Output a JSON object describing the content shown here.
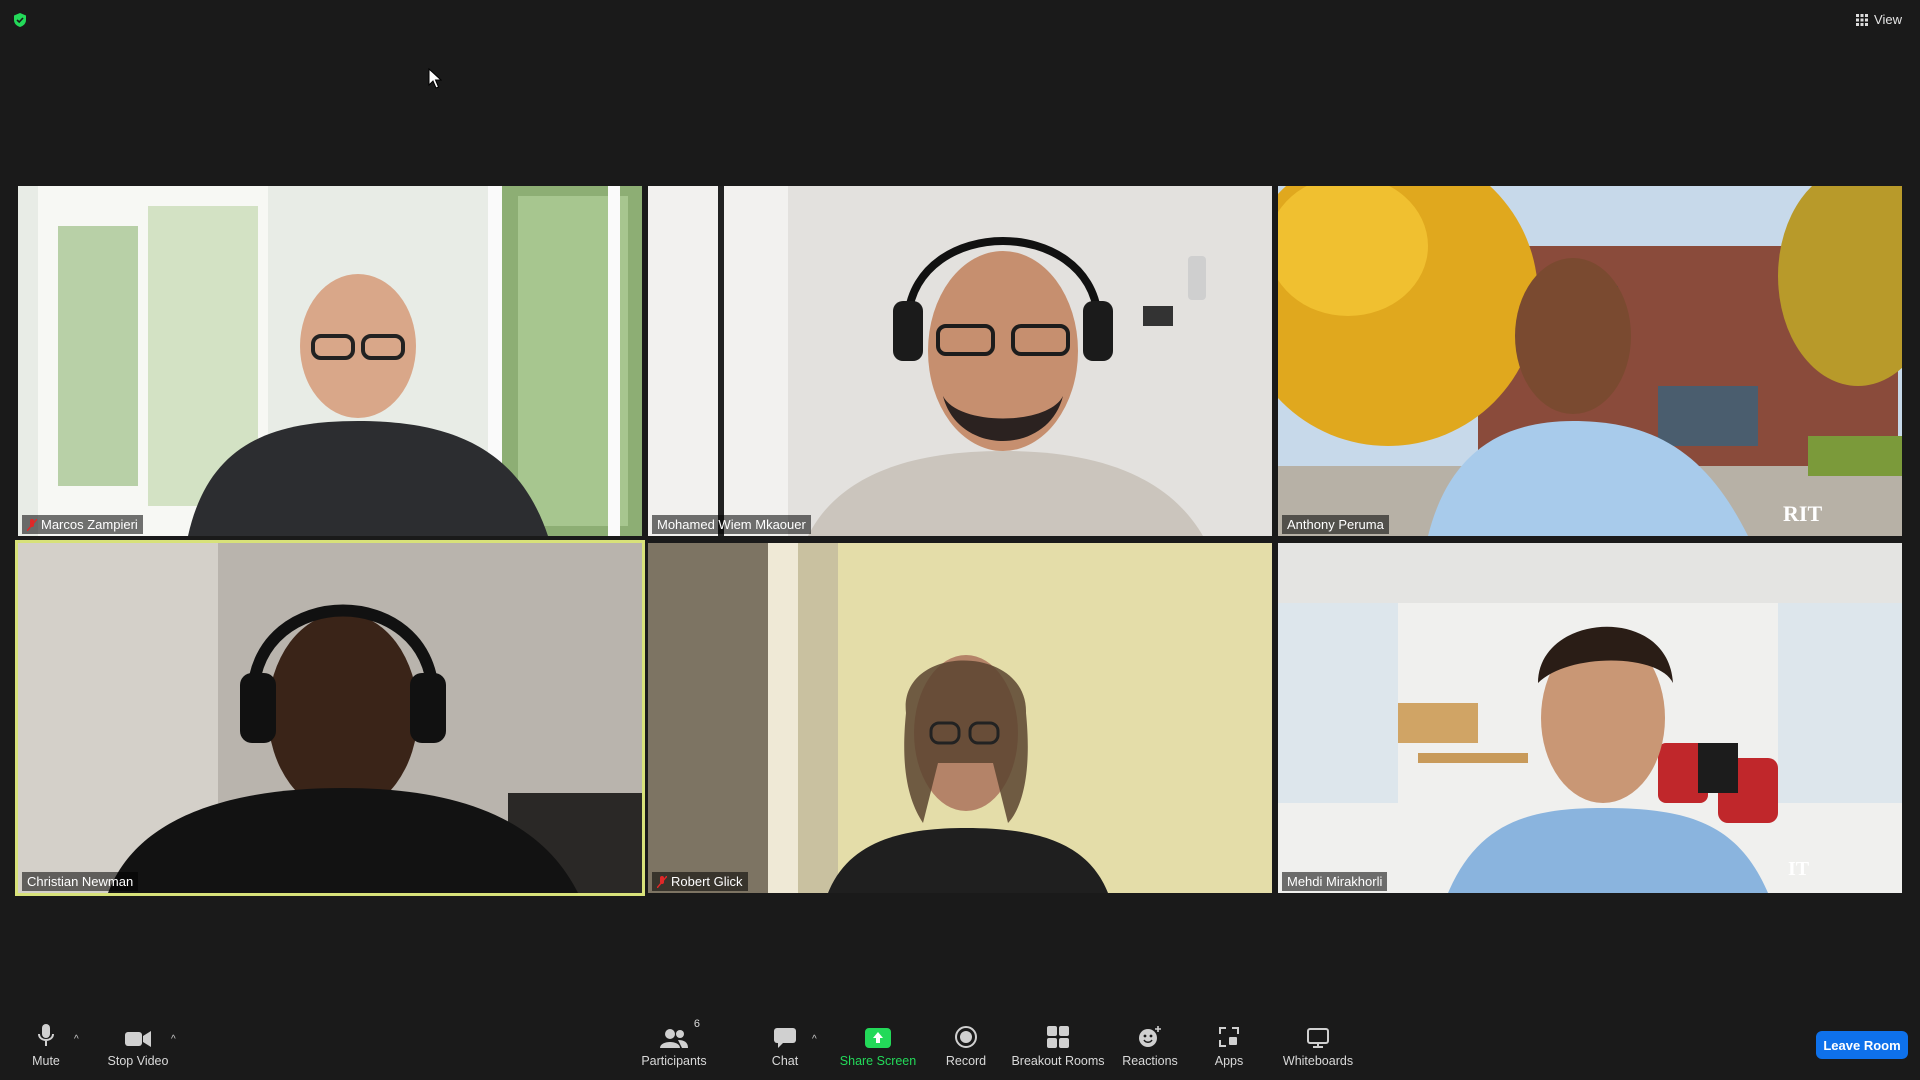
{
  "topbar": {
    "view_label": "View"
  },
  "tiles": [
    {
      "name": "Marcos Zampieri",
      "muted": true
    },
    {
      "name": "Mohamed Wiem Mkaouer",
      "muted": false
    },
    {
      "name": "Anthony Peruma",
      "muted": false
    },
    {
      "name": "Christian Newman",
      "muted": false,
      "active_speaker": true
    },
    {
      "name": "Robert Glick",
      "muted": true
    },
    {
      "name": "Mehdi Mirakhorli",
      "muted": false
    }
  ],
  "toolbar": {
    "mute": "Mute",
    "stop_video": "Stop Video",
    "participants": "Participants",
    "participants_count": "6",
    "chat": "Chat",
    "share_screen": "Share Screen",
    "record": "Record",
    "breakout_rooms": "Breakout Rooms",
    "reactions": "Reactions",
    "apps": "Apps",
    "whiteboards": "Whiteboards",
    "leave_room": "Leave Room"
  },
  "colors": {
    "background": "#1a1a1a",
    "active_speaker_border": "#d8e27a",
    "share_green": "#23d959",
    "leave_blue": "#0e71eb",
    "muted_red": "#e02828"
  },
  "icons": [
    "shield-icon",
    "grid-view-icon",
    "microphone-icon",
    "video-camera-icon",
    "participants-icon",
    "chat-icon",
    "share-screen-icon",
    "record-icon",
    "breakout-rooms-icon",
    "reactions-icon",
    "apps-icon",
    "whiteboard-icon"
  ]
}
